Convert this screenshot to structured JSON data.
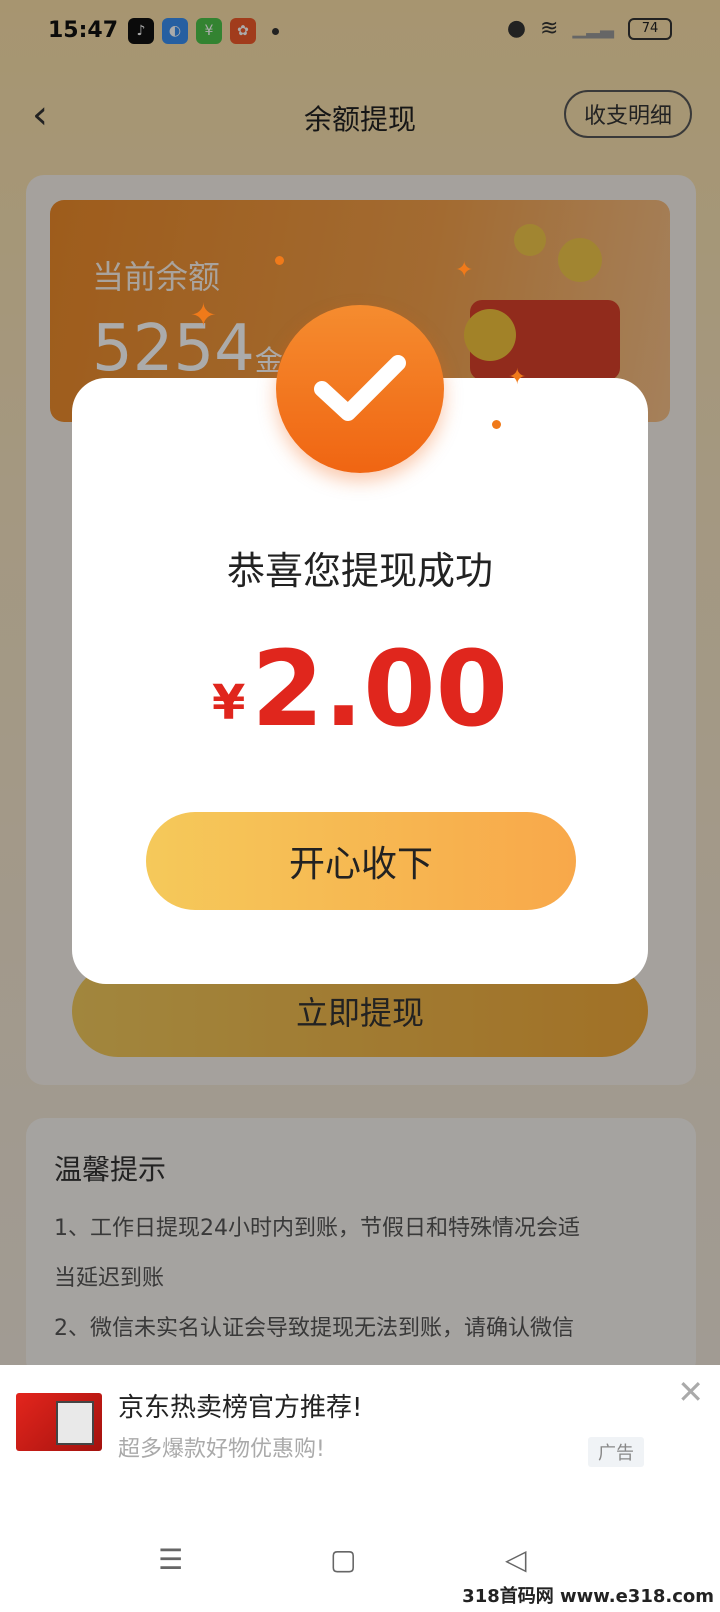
{
  "status": {
    "time": "15:47",
    "battery": "74"
  },
  "header": {
    "title": "余额提现",
    "detail_label": "收支明细"
  },
  "balance": {
    "label": "当前余额",
    "value": "5254",
    "unit": "金"
  },
  "withdraw_button": "立即提现",
  "dialog": {
    "title": "恭喜您提现成功",
    "currency": "¥",
    "amount": "2.00",
    "button": "开心收下"
  },
  "tips": {
    "title": "温馨提示",
    "items": [
      "1、工作日提现24小时内到账，节假日和特殊情况会适",
      "当延迟到账",
      "2、微信未实名认证会导致提现无法到账，请确认微信"
    ]
  },
  "ad": {
    "title": "京东热卖榜官方推荐!",
    "subtitle": "超多爆款好物优惠购!",
    "badge": "广告"
  },
  "watermark": "318首码网 www.e318.com"
}
